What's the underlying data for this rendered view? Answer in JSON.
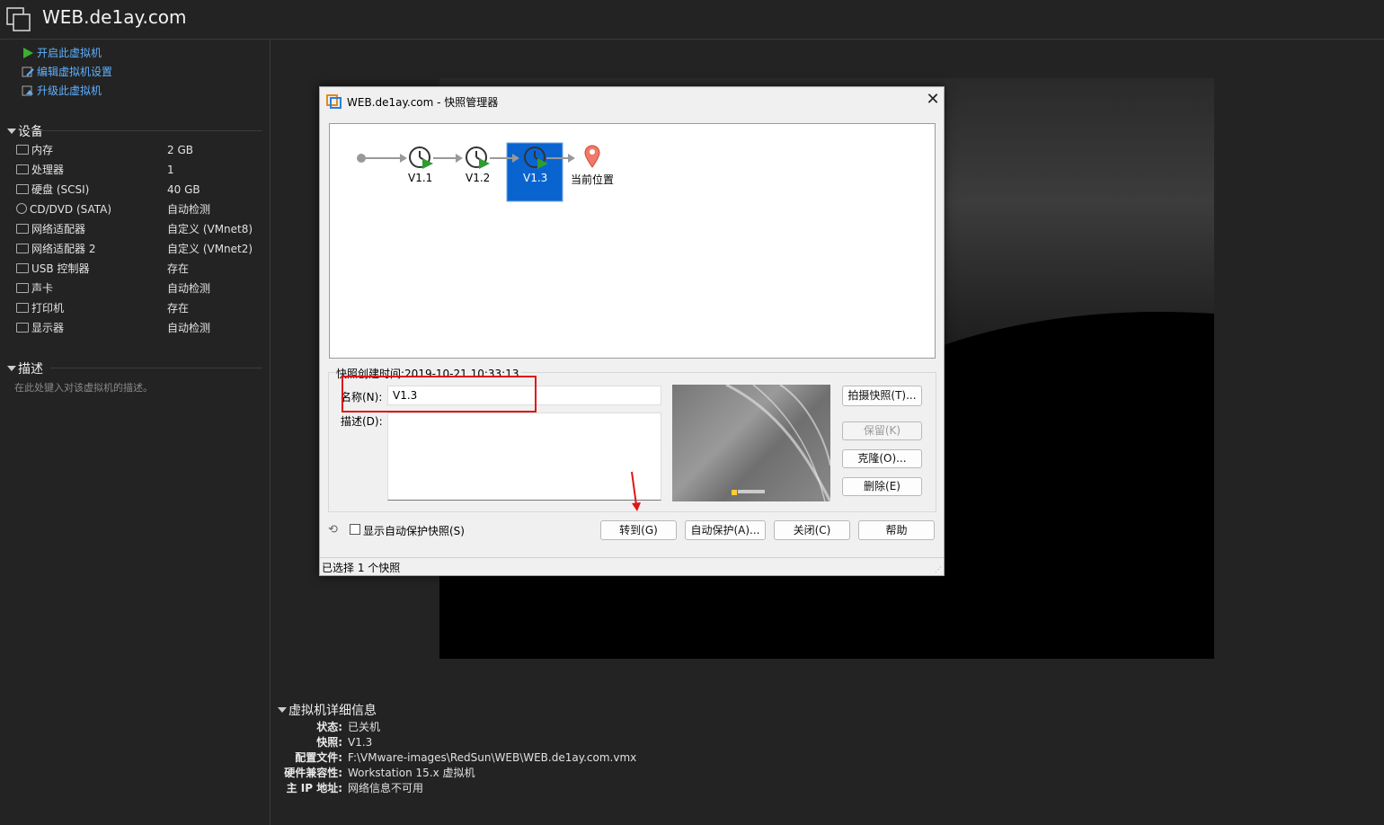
{
  "window": {
    "title": "WEB.de1ay.com"
  },
  "actions": [
    {
      "label": "开启此虚拟机",
      "icon": "play-icon"
    },
    {
      "label": "编辑虚拟机设置",
      "icon": "edit-settings-icon"
    },
    {
      "label": "升级此虚拟机",
      "icon": "upgrade-icon"
    }
  ],
  "devices": {
    "header": "设备",
    "items": [
      {
        "name": "内存",
        "value": "2 GB",
        "icon": "memory-icon"
      },
      {
        "name": "处理器",
        "value": "1",
        "icon": "cpu-icon"
      },
      {
        "name": "硬盘 (SCSI)",
        "value": "40 GB",
        "icon": "hard-disk-icon"
      },
      {
        "name": "CD/DVD (SATA)",
        "value": "自动检测",
        "icon": "cd-dvd-icon"
      },
      {
        "name": "网络适配器",
        "value": "自定义 (VMnet8)",
        "icon": "network-adapter-icon"
      },
      {
        "name": "网络适配器 2",
        "value": "自定义 (VMnet2)",
        "icon": "network-adapter-icon"
      },
      {
        "name": "USB 控制器",
        "value": "存在",
        "icon": "usb-icon"
      },
      {
        "name": "声卡",
        "value": "自动检测",
        "icon": "sound-icon"
      },
      {
        "name": "打印机",
        "value": "存在",
        "icon": "printer-icon"
      },
      {
        "name": "显示器",
        "value": "自动检测",
        "icon": "display-icon"
      }
    ]
  },
  "description": {
    "header": "描述",
    "placeholder": "在此处键入对该虚拟机的描述。"
  },
  "details": {
    "header": "虚拟机详细信息",
    "rows": [
      {
        "label": "状态:",
        "value": "已关机"
      },
      {
        "label": "快照:",
        "value": "V1.3"
      },
      {
        "label": "配置文件:",
        "value": "F:\\VMware-images\\RedSun\\WEB\\WEB.de1ay.com.vmx"
      },
      {
        "label": "硬件兼容性:",
        "value": "Workstation 15.x 虚拟机"
      },
      {
        "label": "主 IP 地址:",
        "value": "网络信息不可用"
      }
    ]
  },
  "snapshot_dialog": {
    "title": "WEB.de1ay.com - 快照管理器",
    "snapshots": [
      "V1.1",
      "V1.2",
      "V1.3"
    ],
    "selected": "V1.3",
    "current_label": "当前位置",
    "created_label": "快照创建时间:2019-10-21 10:33:13",
    "name_label": "名称(N):",
    "name_value": "V1.3",
    "desc_label": "描述(D):",
    "buttons_right": {
      "take": "拍摄快照(T)...",
      "keep": "保留(K)",
      "clone": "克隆(O)...",
      "delete": "删除(E)"
    },
    "show_auto_label": "显示自动保护快照(S)",
    "buttons_bottom": {
      "goto": "转到(G)",
      "autoprotect": "自动保护(A)...",
      "close": "关闭(C)",
      "help": "帮助"
    },
    "status": "已选择 1 个快照"
  }
}
